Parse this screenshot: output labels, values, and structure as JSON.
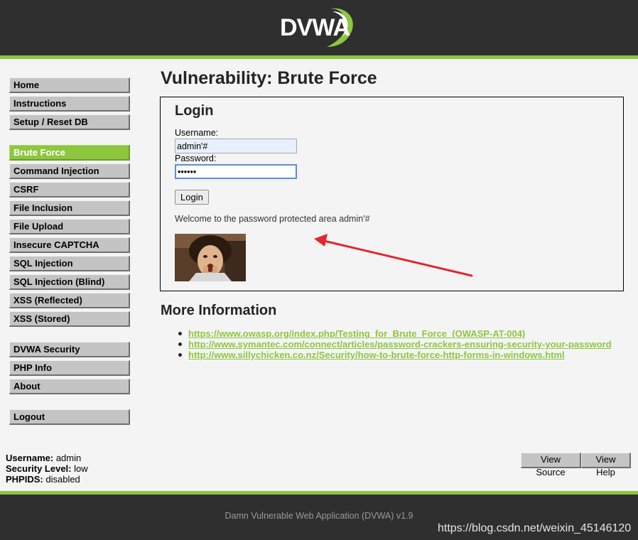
{
  "header": {
    "logo_text": "DVWA",
    "accent_color": "#8dc63f",
    "background_color": "#2f2f2f"
  },
  "sidebar": {
    "groups": [
      [
        {
          "label": "Home"
        },
        {
          "label": "Instructions"
        },
        {
          "label": "Setup / Reset DB"
        }
      ],
      [
        {
          "label": "Brute Force",
          "selected": true
        },
        {
          "label": "Command Injection"
        },
        {
          "label": "CSRF"
        },
        {
          "label": "File Inclusion"
        },
        {
          "label": "File Upload"
        },
        {
          "label": "Insecure CAPTCHA"
        },
        {
          "label": "SQL Injection"
        },
        {
          "label": "SQL Injection (Blind)"
        },
        {
          "label": "XSS (Reflected)"
        },
        {
          "label": "XSS (Stored)"
        }
      ],
      [
        {
          "label": "DVWA Security"
        },
        {
          "label": "PHP Info"
        },
        {
          "label": "About"
        }
      ],
      [
        {
          "label": "Logout"
        }
      ]
    ]
  },
  "main": {
    "title": "Vulnerability: Brute Force",
    "login": {
      "heading": "Login",
      "username_label": "Username:",
      "username_value": "admin'#",
      "password_label": "Password:",
      "password_value": "••••••",
      "button_label": "Login",
      "welcome_message": "Welcome to the password protected area admin'#",
      "photo_icon": "user-photo"
    },
    "more_info": {
      "heading": "More Information",
      "links": [
        "https://www.owasp.org/index.php/Testing_for_Brute_Force_(OWASP-AT-004)",
        "http://www.symantec.com/connect/articles/password-crackers-ensuring-security-your-password",
        "http://www.sillychicken.co.nz/Security/how-to-brute-force-http-forms-in-windows.html"
      ]
    },
    "annotation_color": "#e0282e"
  },
  "status": {
    "username_label": "Username:",
    "username_value": "admin",
    "security_label": "Security Level:",
    "security_value": "low",
    "phpids_label": "PHPIDS:",
    "phpids_value": "disabled"
  },
  "buttons": {
    "view_source": "View Source",
    "view_help": "View Help"
  },
  "footer": {
    "text": "Damn Vulnerable Web Application (DVWA) v1.9",
    "watermark": "https://blog.csdn.net/weixin_45146120"
  }
}
